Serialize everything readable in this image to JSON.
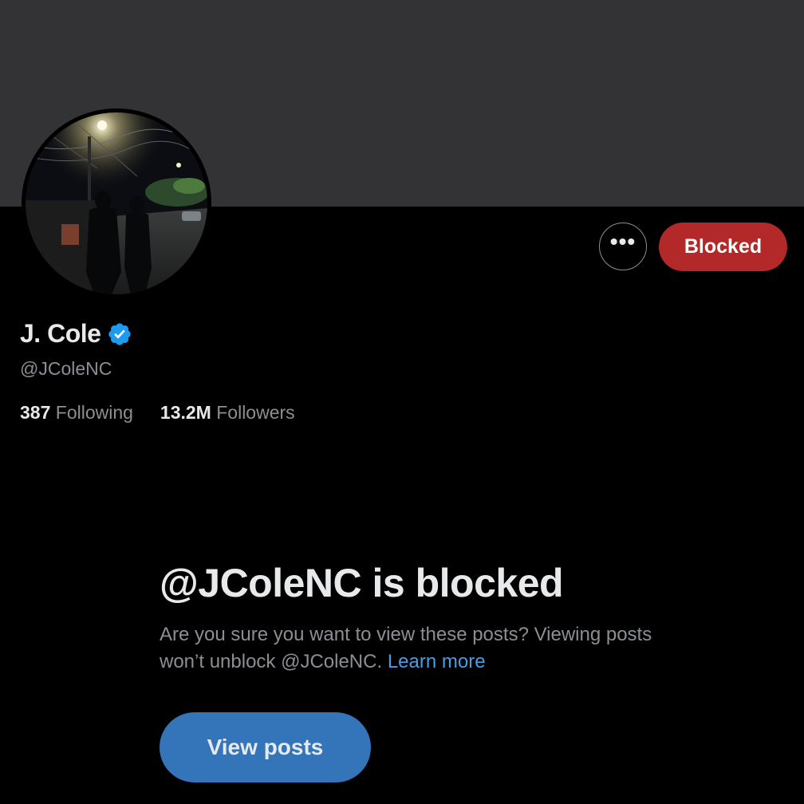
{
  "profile": {
    "display_name": "J. Cole",
    "handle": "@JColeNC",
    "verified_icon": "verified-badge-icon",
    "avatar_icon": "profile-photo"
  },
  "actions": {
    "more_icon": "more-options-icon",
    "more_label": "•••",
    "blocked_label": "Blocked"
  },
  "stats": {
    "following_count": "387",
    "following_label": "Following",
    "followers_count": "13.2M",
    "followers_label": "Followers"
  },
  "blocked_notice": {
    "title": "@JColeNC is blocked",
    "description": "Are you sure you want to view these posts? Viewing posts won’t unblock @JColeNC.",
    "learn_more": "Learn more",
    "view_posts_label": "View posts"
  },
  "colors": {
    "background": "#000000",
    "banner": "#333336",
    "blocked_red": "#b3292a",
    "accent_blue": "#3475b9",
    "link_blue": "#4a9de4",
    "verified_blue": "#1d9bf0",
    "text_primary": "#e7e9ea",
    "text_secondary": "#8b8f94"
  }
}
